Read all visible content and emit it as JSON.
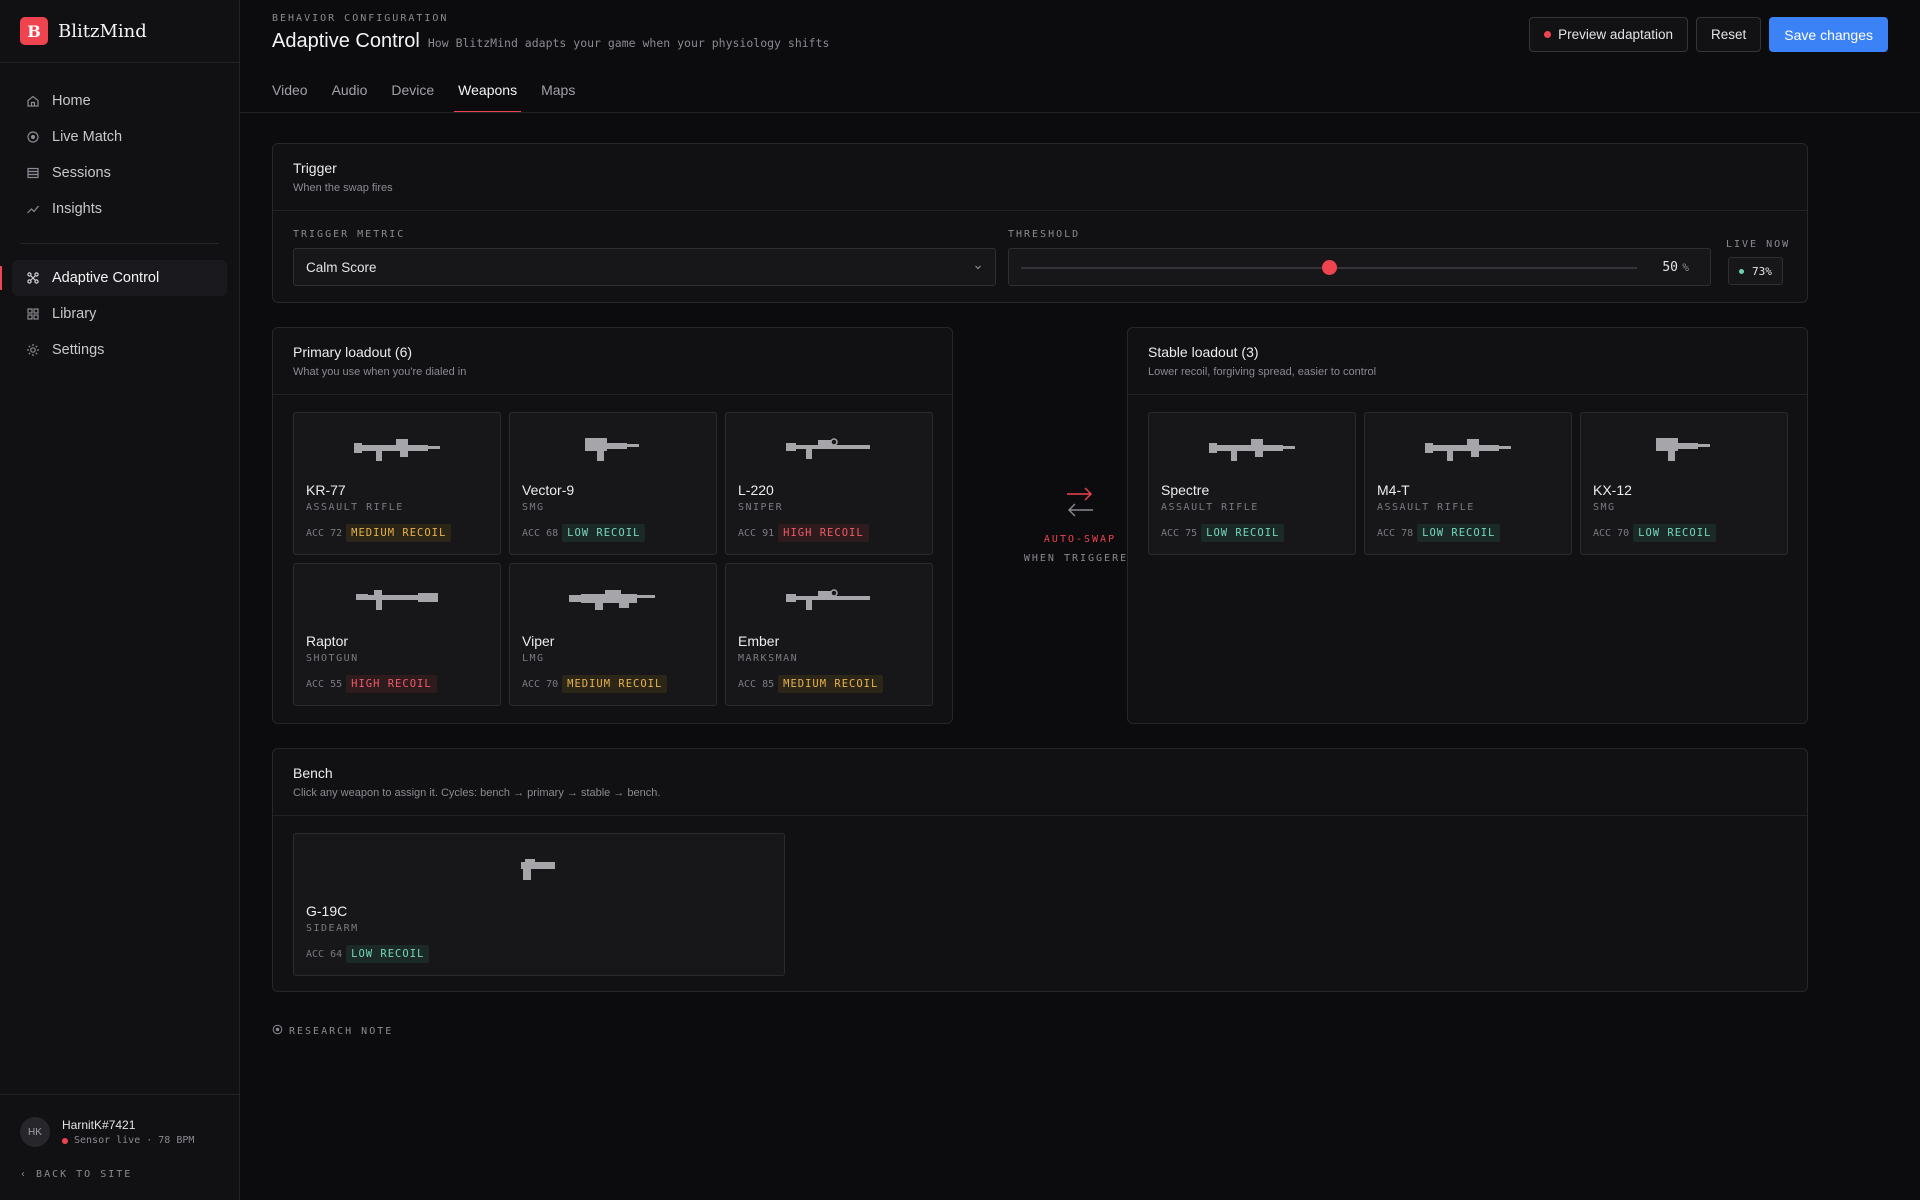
{
  "brand": {
    "logo_letter": "B",
    "name": "BlitzMind"
  },
  "nav": {
    "items": [
      {
        "label": "Home",
        "icon": "home-icon"
      },
      {
        "label": "Live Match",
        "icon": "target-icon"
      },
      {
        "label": "Sessions",
        "icon": "layers-icon"
      },
      {
        "label": "Insights",
        "icon": "trend-icon"
      },
      {
        "label": "Adaptive Control",
        "icon": "control-icon",
        "active": true
      },
      {
        "label": "Library",
        "icon": "grid-icon"
      },
      {
        "label": "Settings",
        "icon": "gear-icon"
      }
    ]
  },
  "user": {
    "initials": "HK",
    "name": "HarnitK#7421",
    "status": "Sensor live · 78 BPM",
    "back": "BACK TO SITE"
  },
  "header": {
    "eyebrow": "BEHAVIOR CONFIGURATION",
    "title": "Adaptive Control",
    "subtitle": "How BlitzMind adapts your game when your physiology shifts",
    "preview": "Preview adaptation",
    "reset": "Reset",
    "save": "Save changes"
  },
  "tabs": [
    {
      "label": "Video"
    },
    {
      "label": "Audio"
    },
    {
      "label": "Device"
    },
    {
      "label": "Weapons",
      "active": true
    },
    {
      "label": "Maps"
    }
  ],
  "trigger": {
    "title": "Trigger",
    "subtitle": "When the swap fires",
    "metric_label": "TRIGGER METRIC",
    "metric_value": "Calm Score",
    "threshold_label": "THRESHOLD",
    "threshold_value": "50",
    "threshold_fraction": 0.5,
    "threshold_unit": "%",
    "live_label": "LIVE NOW",
    "live_value": "73%"
  },
  "primary": {
    "title": "Primary loadout (6)",
    "subtitle": "What you use when you're dialed in",
    "cards": [
      {
        "name": "KR-77",
        "type": "ASSAULT RIFLE",
        "acc": "ACC 72",
        "recoil": "MEDIUM RECOIL",
        "level": "med",
        "icon": "assault-rifle-icon"
      },
      {
        "name": "Vector-9",
        "type": "SMG",
        "acc": "ACC 68",
        "recoil": "LOW RECOIL",
        "level": "low",
        "icon": "smg-icon"
      },
      {
        "name": "L-220",
        "type": "SNIPER",
        "acc": "ACC 91",
        "recoil": "HIGH RECOIL",
        "level": "high",
        "icon": "sniper-icon"
      },
      {
        "name": "Raptor",
        "type": "SHOTGUN",
        "acc": "ACC 55",
        "recoil": "HIGH RECOIL",
        "level": "high",
        "icon": "shotgun-icon"
      },
      {
        "name": "Viper",
        "type": "LMG",
        "acc": "ACC 70",
        "recoil": "MEDIUM RECOIL",
        "level": "med",
        "icon": "lmg-icon"
      },
      {
        "name": "Ember",
        "type": "MARKSMAN",
        "acc": "ACC 85",
        "recoil": "MEDIUM RECOIL",
        "level": "med",
        "icon": "marksman-icon"
      }
    ]
  },
  "swap": {
    "line1": "AUTO-SWAP",
    "line2": "WHEN TRIGGERED"
  },
  "stable": {
    "title": "Stable loadout (3)",
    "subtitle": "Lower recoil, forgiving spread, easier to control",
    "cards": [
      {
        "name": "Spectre",
        "type": "ASSAULT RIFLE",
        "acc": "ACC 75",
        "recoil": "LOW RECOIL",
        "level": "low",
        "icon": "assault-rifle-icon"
      },
      {
        "name": "M4-T",
        "type": "ASSAULT RIFLE",
        "acc": "ACC 78",
        "recoil": "LOW RECOIL",
        "level": "low",
        "icon": "assault-rifle-icon"
      },
      {
        "name": "KX-12",
        "type": "SMG",
        "acc": "ACC 70",
        "recoil": "LOW RECOIL",
        "level": "low",
        "icon": "smg-icon"
      }
    ]
  },
  "bench": {
    "title": "Bench",
    "subtitle": "Click any weapon to assign it. Cycles: bench → primary → stable → bench.",
    "cards": [
      {
        "name": "G-19C",
        "type": "SIDEARM",
        "acc": "ACC 64",
        "recoil": "LOW RECOIL",
        "level": "low",
        "icon": "pistol-icon"
      }
    ]
  },
  "note": "RESEARCH NOTE",
  "colors": {
    "accent": "#ef4350",
    "primary_button": "#3b82f6",
    "low": "#76d6bd",
    "medium": "#e9b24a",
    "high": "#ef5b66"
  }
}
